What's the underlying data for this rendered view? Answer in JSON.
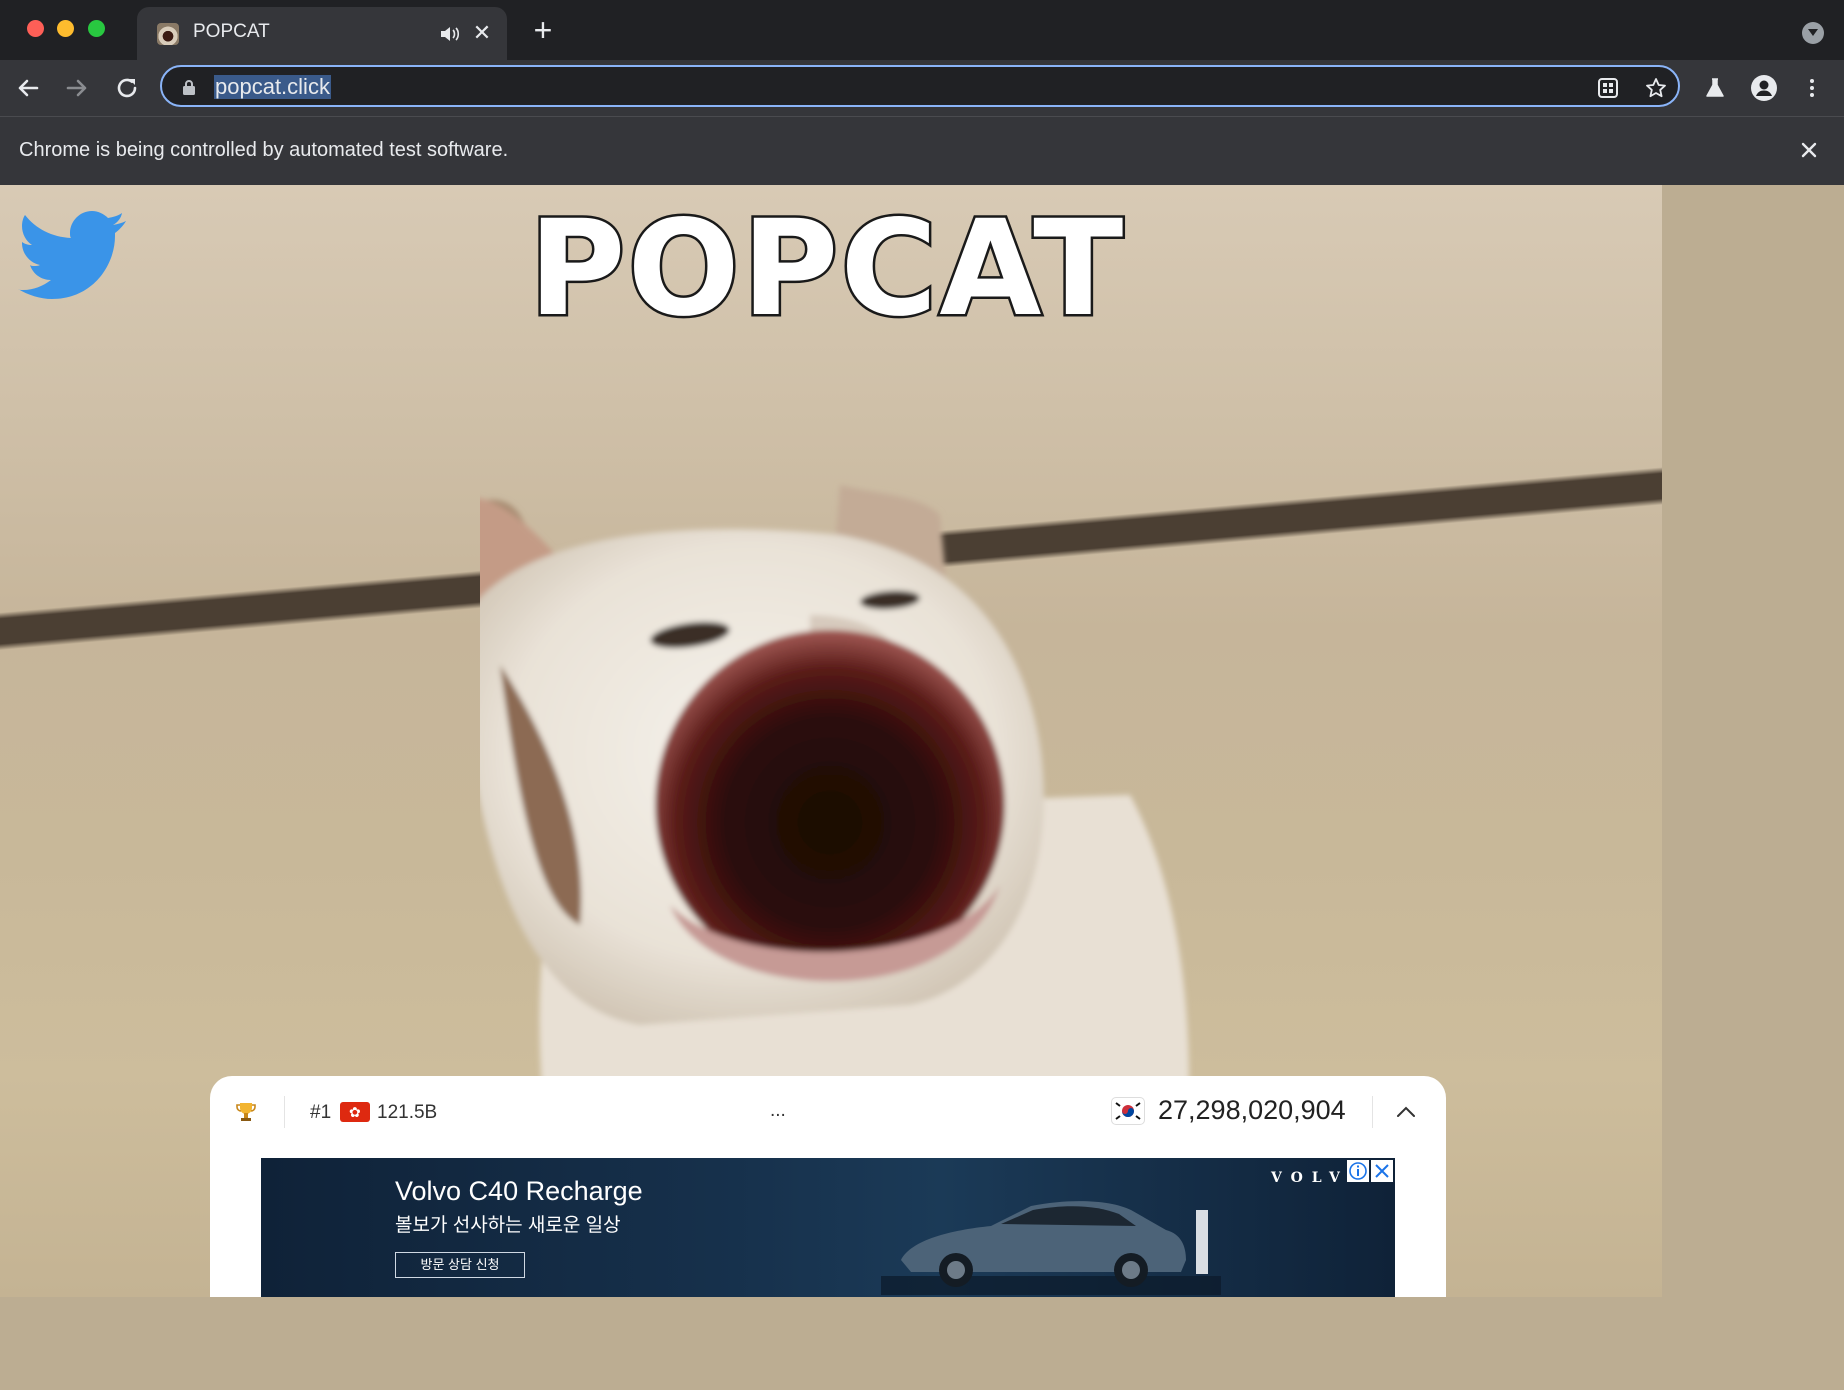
{
  "browser": {
    "tab": {
      "title": "POPCAT"
    },
    "address_bar": {
      "url": "popcat.click"
    },
    "infobar": {
      "message": "Chrome is being controlled by automated test software."
    }
  },
  "page": {
    "title": "POPCAT",
    "leaderboard": {
      "top_rank": "#1",
      "top_country_score": "121.5B",
      "middle_text": "...",
      "total_clicks": "27,298,020,904"
    },
    "ad": {
      "title": "Volvo C40 Recharge",
      "subtitle": "볼보가 선사하는 새로운 일상",
      "cta": "방문 상담 신청",
      "brand": "VOLVO"
    }
  },
  "icons": {
    "tab_audio": "speaker-icon",
    "tab_close": "close-icon",
    "new_tab": "plus-icon",
    "back": "arrow-left-icon",
    "forward": "arrow-right-icon",
    "reload": "reload-icon",
    "lock": "lock-icon",
    "bookmark": "star-icon",
    "profile": "person-icon",
    "menu": "kebab-icon",
    "social": "twitter-icon",
    "leaderboard": "trophy-icon",
    "expand": "chevron-up-icon"
  }
}
